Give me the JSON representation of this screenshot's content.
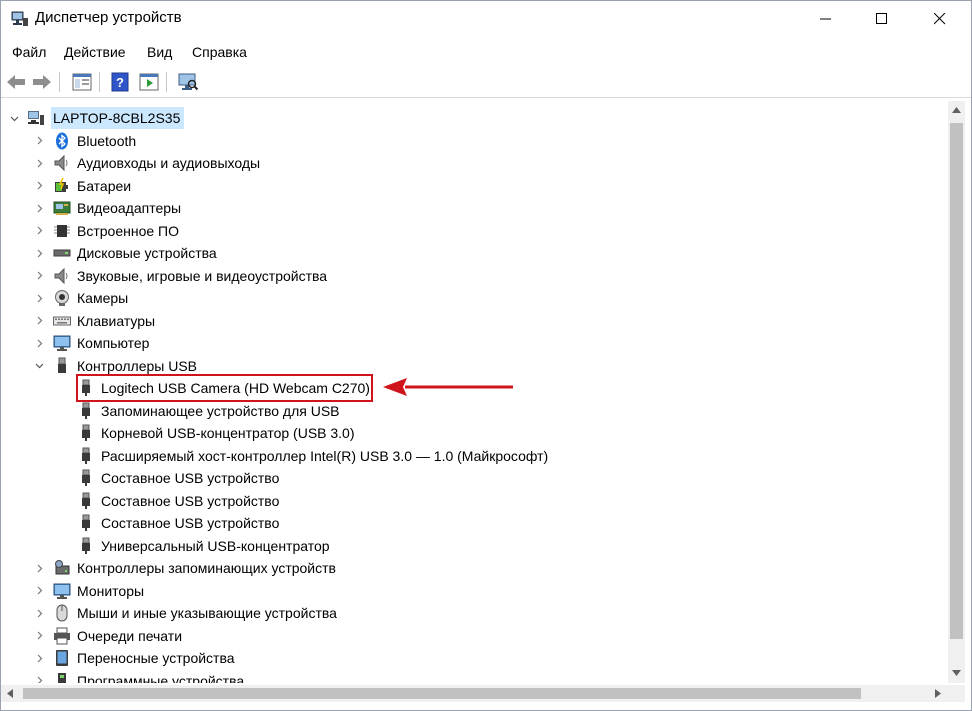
{
  "window": {
    "title": "Диспетчер устройств"
  },
  "menu": [
    "Файл",
    "Действие",
    "Вид",
    "Справка"
  ],
  "tree": {
    "root": "LAPTOP-8CBL2S35",
    "categories": [
      {
        "label": "Bluetooth",
        "icon": "bluetooth-icon"
      },
      {
        "label": "Аудиовходы и аудиовыходы",
        "icon": "speaker-icon"
      },
      {
        "label": "Батареи",
        "icon": "battery-icon"
      },
      {
        "label": "Видеоадаптеры",
        "icon": "display-adapter-icon"
      },
      {
        "label": "Встроенное ПО",
        "icon": "firmware-chip-icon"
      },
      {
        "label": "Дисковые устройства",
        "icon": "disk-drive-icon"
      },
      {
        "label": "Звуковые, игровые и видеоустройства",
        "icon": "speaker-icon"
      },
      {
        "label": "Камеры",
        "icon": "camera-icon"
      },
      {
        "label": "Клавиатуры",
        "icon": "keyboard-icon"
      },
      {
        "label": "Компьютер",
        "icon": "monitor-icon"
      },
      {
        "label": "Контроллеры USB",
        "icon": "usb-icon",
        "expanded": true
      }
    ],
    "usb_children": [
      "Logitech USB Camera (HD Webcam C270)",
      "Запоминающее устройство для USB",
      "Корневой USB-концентратор (USB 3.0)",
      "Расширяемый хост-контроллер Intel(R) USB 3.0 — 1.0 (Майкрософт)",
      "Составное USB устройство",
      "Составное USB устройство",
      "Составное USB устройство",
      "Универсальный USB-концентратор"
    ],
    "categories_after": [
      {
        "label": "Контроллеры запоминающих устройств",
        "icon": "storage-controller-icon"
      },
      {
        "label": "Мониторы",
        "icon": "monitor-icon"
      },
      {
        "label": "Мыши и иные указывающие устройства",
        "icon": "mouse-icon"
      },
      {
        "label": "Очереди печати",
        "icon": "printer-icon"
      },
      {
        "label": "Переносные устройства",
        "icon": "portable-device-icon"
      },
      {
        "label": "Программные устройства",
        "icon": "software-device-icon"
      }
    ]
  },
  "annotation": {
    "highlight_color": "#d0141c",
    "selection_color": "#cce8ff"
  }
}
